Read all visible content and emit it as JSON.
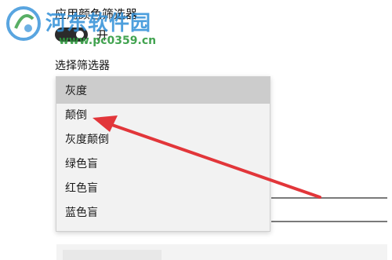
{
  "settings": {
    "apply_filter_title": "应用颜色筛选器",
    "toggle_state_label": "开",
    "toggle_on": true,
    "select_filter_label": "选择筛选器"
  },
  "dropdown": {
    "options": [
      {
        "label": "灰度",
        "selected": true
      },
      {
        "label": "颠倒",
        "selected": false
      },
      {
        "label": "灰度颠倒",
        "selected": false
      },
      {
        "label": "绿色盲",
        "selected": false
      },
      {
        "label": "红色盲",
        "selected": false
      },
      {
        "label": "蓝色盲",
        "selected": false
      }
    ]
  },
  "annotation": {
    "arrow_color": "#e2363a",
    "points_to": "颠倒"
  },
  "watermark": {
    "site_name": "河东软件园",
    "url": "www.pc0359.cn"
  },
  "colors": {
    "toggle_bg": "#2b2b2b",
    "selected_bg": "#cccccc",
    "dropdown_bg": "#f2f2f2"
  }
}
